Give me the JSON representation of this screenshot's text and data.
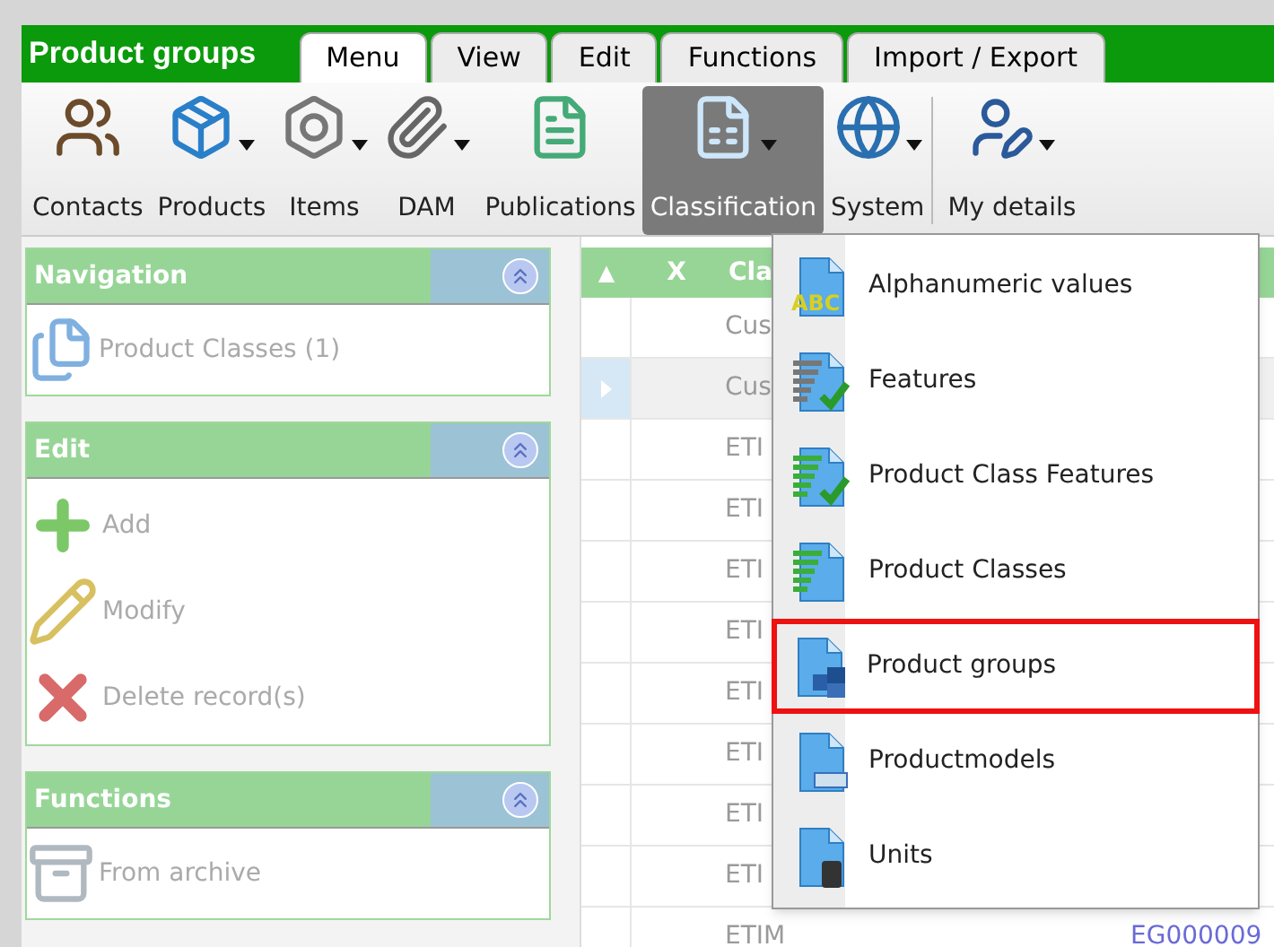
{
  "title": "Product groups",
  "tabs": [
    {
      "label": "Menu",
      "selected": true
    },
    {
      "label": "View",
      "selected": false
    },
    {
      "label": "Edit",
      "selected": false
    },
    {
      "label": "Functions",
      "selected": false
    },
    {
      "label": "Import / Export",
      "selected": false
    }
  ],
  "toolbar": [
    {
      "label": "Contacts",
      "dropdown": false,
      "active": false
    },
    {
      "label": "Products",
      "dropdown": true,
      "active": false
    },
    {
      "label": "Items",
      "dropdown": true,
      "active": false
    },
    {
      "label": "DAM",
      "dropdown": true,
      "active": false
    },
    {
      "label": "Publications",
      "dropdown": false,
      "active": false
    },
    {
      "label": "Classification",
      "dropdown": true,
      "active": true
    },
    {
      "label": "System",
      "dropdown": true,
      "active": false
    },
    {
      "label": "My details",
      "dropdown": true,
      "active": false
    }
  ],
  "panels": [
    {
      "title": "Navigation",
      "items": [
        {
          "label": "Product Classes (1)",
          "disabled": true
        }
      ]
    },
    {
      "title": "Edit",
      "items": [
        {
          "label": "Add",
          "disabled": true
        },
        {
          "label": "Modify",
          "disabled": true
        },
        {
          "label": "Delete record(s)",
          "disabled": true
        }
      ]
    },
    {
      "title": "Functions",
      "items": [
        {
          "label": "From archive",
          "disabled": true
        }
      ]
    }
  ],
  "grid": {
    "columns": [
      "▲",
      "X",
      "Cla"
    ],
    "rows": [
      {
        "cells": [
          "Cus"
        ],
        "selected": false
      },
      {
        "cells": [
          "Cus"
        ],
        "selected": true
      },
      {
        "cells": [
          "ETI"
        ],
        "selected": false
      },
      {
        "cells": [
          "ETI"
        ],
        "selected": false
      },
      {
        "cells": [
          "ETI"
        ],
        "selected": false
      },
      {
        "cells": [
          "ETI"
        ],
        "selected": false
      },
      {
        "cells": [
          "ETI"
        ],
        "selected": false
      },
      {
        "cells": [
          "ETI"
        ],
        "selected": false
      },
      {
        "cells": [
          "ETI"
        ],
        "selected": false
      },
      {
        "cells": [
          "ETI"
        ],
        "selected": false
      },
      {
        "cells": [
          "ETIM",
          "EG000009"
        ],
        "selected": false
      }
    ]
  },
  "dropdown_menu": [
    {
      "label": "Alphanumeric values",
      "selected": false,
      "icon_label": "ABC"
    },
    {
      "label": "Features",
      "selected": false
    },
    {
      "label": "Product Class Features",
      "selected": false
    },
    {
      "label": "Product Classes",
      "selected": false
    },
    {
      "label": "Product groups",
      "selected": true
    },
    {
      "label": "Productmodels",
      "selected": false
    },
    {
      "label": "Units",
      "selected": false
    }
  ]
}
